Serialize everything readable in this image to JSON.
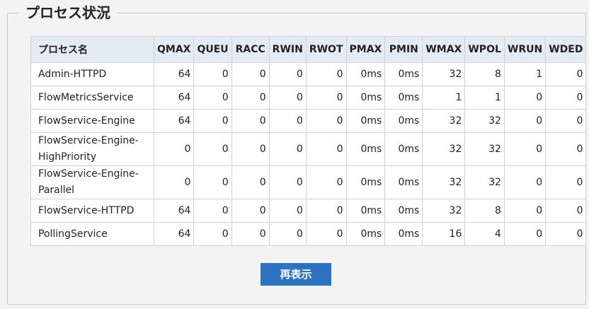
{
  "section": {
    "title": "プロセス状況"
  },
  "table": {
    "headers": [
      "プロセス名",
      "QMAX",
      "QUEU",
      "RACC",
      "RWIN",
      "RWOT",
      "PMAX",
      "PMIN",
      "WMAX",
      "WPOL",
      "WRUN",
      "WDED"
    ],
    "rows": [
      [
        "Admin-HTTPD",
        "64",
        "0",
        "0",
        "0",
        "0",
        "0ms",
        "0ms",
        "32",
        "8",
        "1",
        "0"
      ],
      [
        "FlowMetricsService",
        "64",
        "0",
        "0",
        "0",
        "0",
        "0ms",
        "0ms",
        "1",
        "1",
        "0",
        "0"
      ],
      [
        "FlowService-Engine",
        "64",
        "0",
        "0",
        "0",
        "0",
        "0ms",
        "0ms",
        "32",
        "32",
        "0",
        "0"
      ],
      [
        "FlowService-Engine-HighPriority",
        "0",
        "0",
        "0",
        "0",
        "0",
        "0ms",
        "0ms",
        "32",
        "32",
        "0",
        "0"
      ],
      [
        "FlowService-Engine-Parallel",
        "0",
        "0",
        "0",
        "0",
        "0",
        "0ms",
        "0ms",
        "32",
        "32",
        "0",
        "0"
      ],
      [
        "FlowService-HTTPD",
        "64",
        "0",
        "0",
        "0",
        "0",
        "0ms",
        "0ms",
        "32",
        "8",
        "0",
        "0"
      ],
      [
        "PollingService",
        "64",
        "0",
        "0",
        "0",
        "0",
        "0ms",
        "0ms",
        "16",
        "4",
        "0",
        "0"
      ]
    ]
  },
  "refresh_button": {
    "label": "再表示"
  }
}
